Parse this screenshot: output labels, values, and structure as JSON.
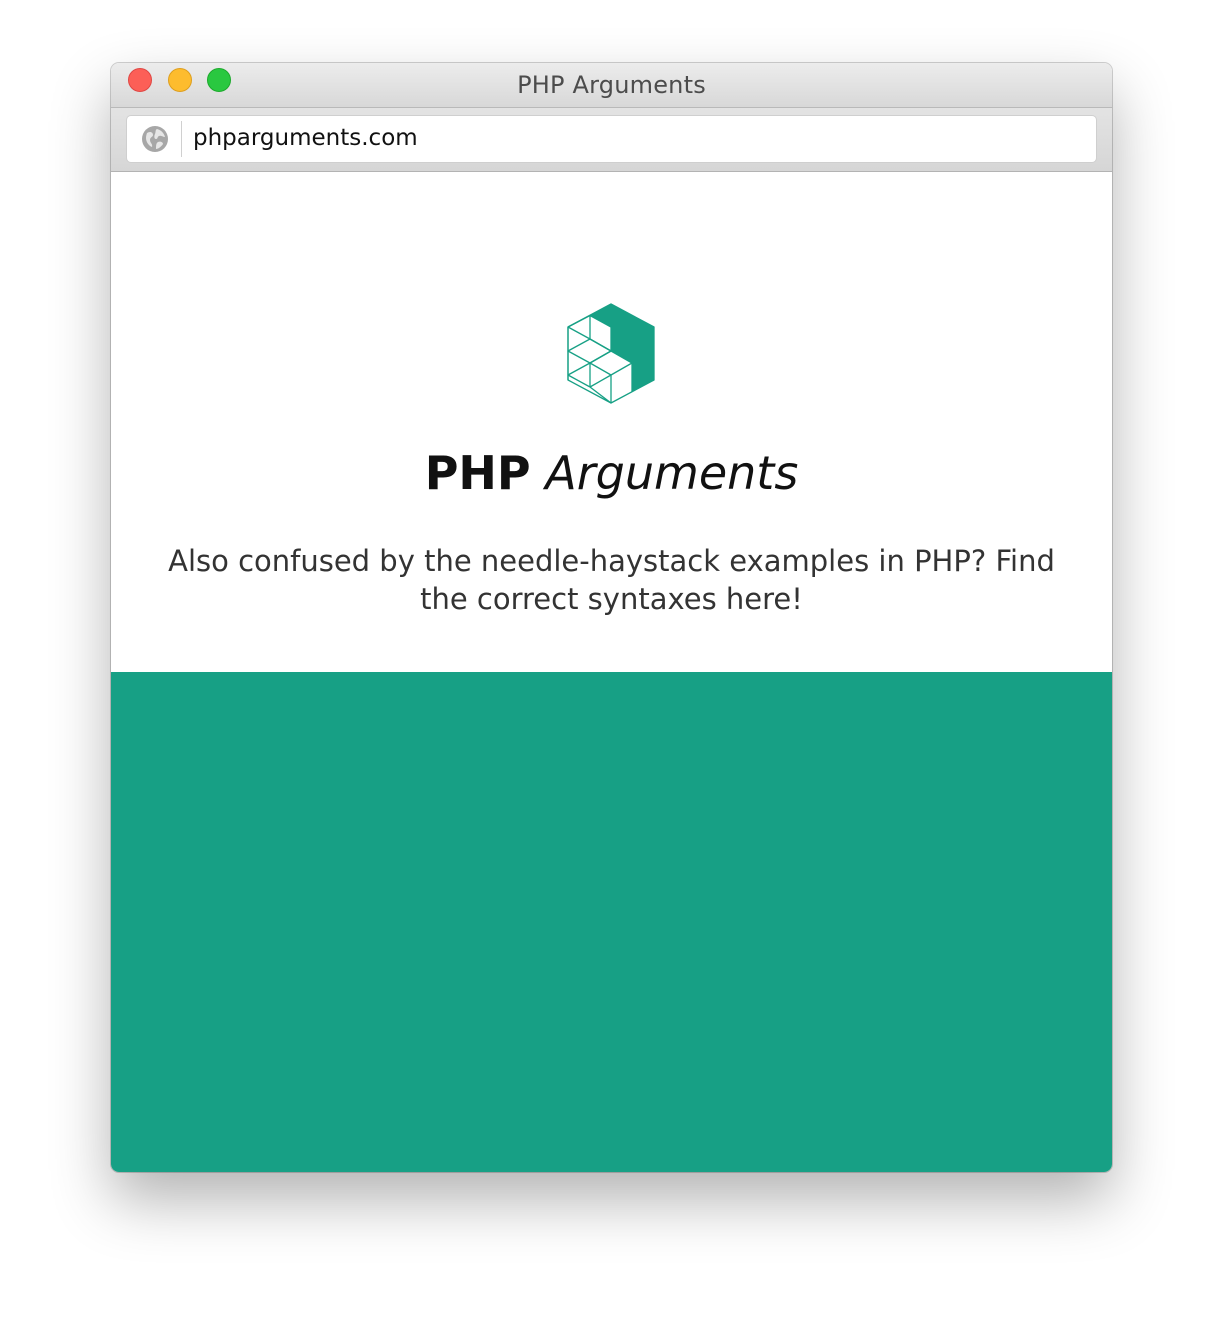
{
  "window": {
    "title": "PHP Arguments"
  },
  "toolbar": {
    "url": "phparguments.com"
  },
  "hero": {
    "title_bold": "PHP",
    "title_italic": "Arguments",
    "tagline": "Also confused by the needle-haystack examples in PHP? Find the correct syntaxes here!"
  },
  "colors": {
    "accent": "#17a085",
    "close": "#fc5f57",
    "minimize": "#fdbc2e",
    "maximize": "#29c840"
  },
  "icons": {
    "logo": "cubes-hexagon-logo",
    "site": "globe-icon"
  }
}
